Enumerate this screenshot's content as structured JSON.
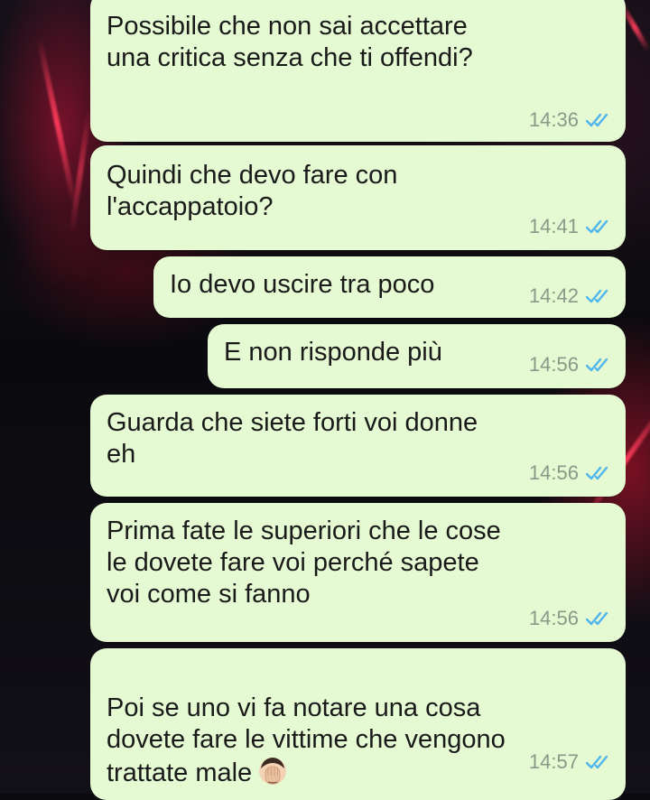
{
  "chat": {
    "messages": [
      {
        "text": "Possibile che non sai accettare\nuna critica senza che ti offendi?",
        "time": "14:36",
        "status_icon": "double-check-icon",
        "emoji": null
      },
      {
        "text": "Quindi che devo fare con\nl'accappatoio?",
        "time": "14:41",
        "status_icon": "double-check-icon",
        "emoji": null
      },
      {
        "text": "Io devo uscire tra poco",
        "time": "14:42",
        "status_icon": "double-check-icon",
        "emoji": null
      },
      {
        "text": "E non risponde più",
        "time": "14:56",
        "status_icon": "double-check-icon",
        "emoji": null
      },
      {
        "text": "Guarda che siete forti voi donne\neh",
        "time": "14:56",
        "status_icon": "double-check-icon",
        "emoji": null
      },
      {
        "text": "Prima fate le superiori che le cose\nle dovete fare voi perché sapete\nvoi come si fanno",
        "time": "14:56",
        "status_icon": "double-check-icon",
        "emoji": null
      },
      {
        "text": "Poi se uno vi fa notare una cosa\ndovete fare le vittime che vengono\ntrattate male",
        "time": "14:57",
        "status_icon": "double-check-icon",
        "emoji": "face-palm-emoji"
      }
    ]
  },
  "colors": {
    "bubble_background": "#e5f9d2",
    "read_tick": "#4fb6ec",
    "timestamp": "#8a9a88"
  }
}
